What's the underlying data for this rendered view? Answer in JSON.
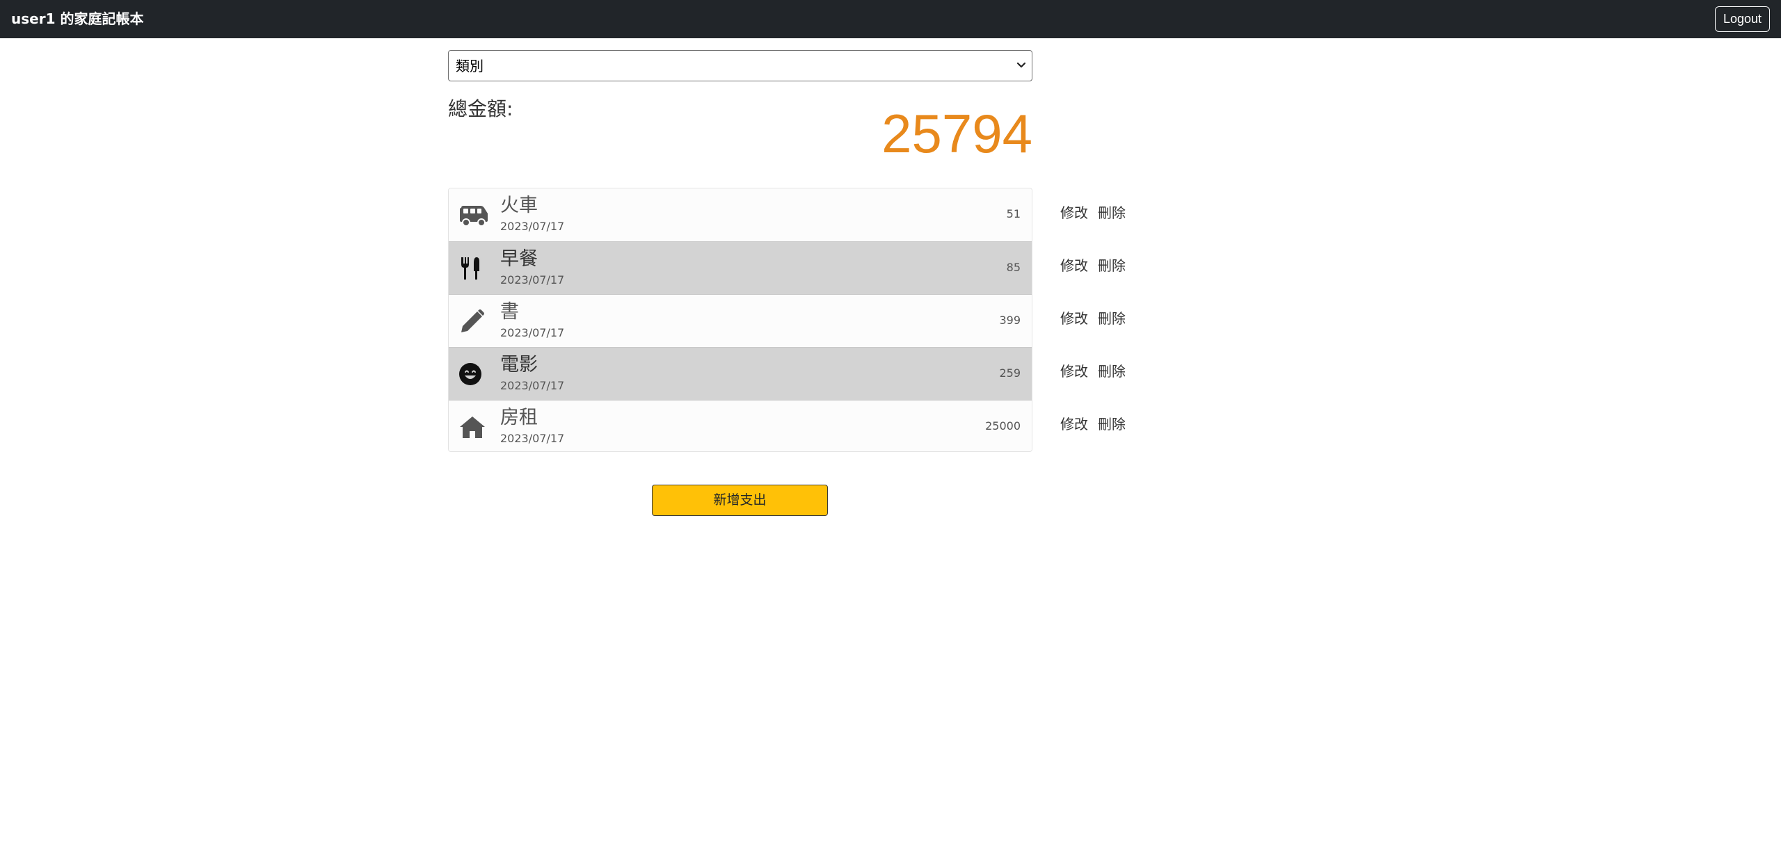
{
  "navbar": {
    "brand": "user1 的家庭記帳本",
    "logout_label": "Logout"
  },
  "filter": {
    "selected": "類別"
  },
  "summary": {
    "total_label": "總金額:",
    "total_value": "25794",
    "total_color": "#e8891c"
  },
  "expenses": [
    {
      "icon": "van-icon",
      "title": "火車",
      "date": "2023/07/17",
      "amount": "51"
    },
    {
      "icon": "utensils-icon",
      "title": "早餐",
      "date": "2023/07/17",
      "amount": "85"
    },
    {
      "icon": "pencil-icon",
      "title": "書",
      "date": "2023/07/17",
      "amount": "399"
    },
    {
      "icon": "smile-icon",
      "title": "電影",
      "date": "2023/07/17",
      "amount": "259"
    },
    {
      "icon": "home-icon",
      "title": "房租",
      "date": "2023/07/17",
      "amount": "25000"
    }
  ],
  "row_actions": {
    "edit_label": "修改",
    "delete_label": "刪除"
  },
  "add_button": {
    "label": "新增支出",
    "color": "#ffc107"
  }
}
